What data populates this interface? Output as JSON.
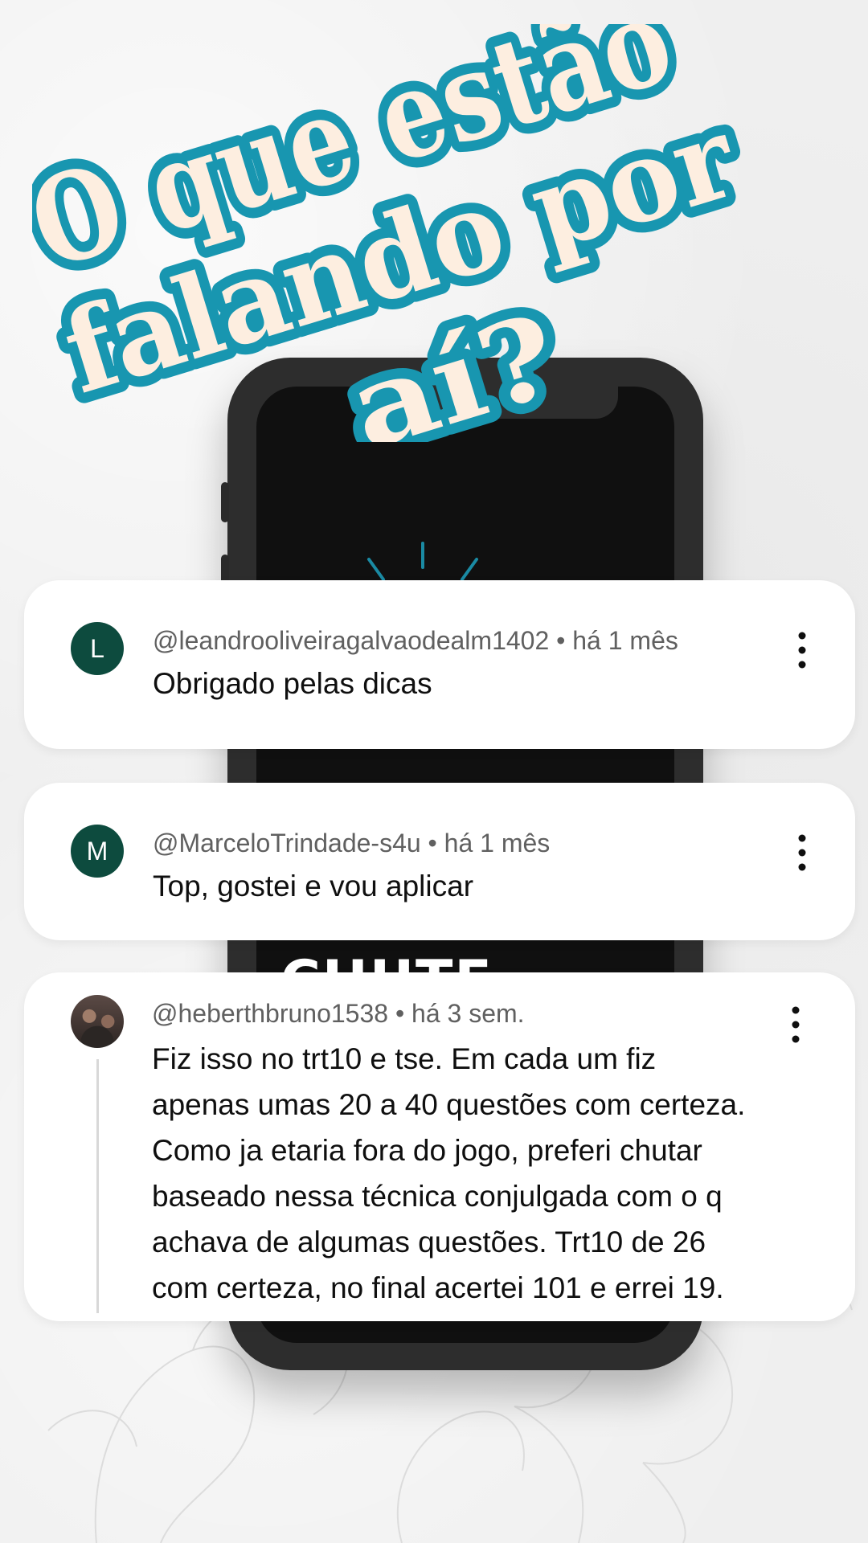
{
  "headline": {
    "line1": "O que estão",
    "line2": "falando por",
    "line3": "aí?",
    "fill_color": "#fdeee0",
    "outline_color": "#1896b0"
  },
  "phone": {
    "screen_partial_text": "CHUTE CERTA"
  },
  "comments": [
    {
      "avatar_letter": "L",
      "avatar_color": "#0d4b3e",
      "meta": "@leandrooliveiragalvaodealm1402 • há 1 mês",
      "text": "Obrigado pelas dicas",
      "menu_icon": "more-vert-icon"
    },
    {
      "avatar_letter": "M",
      "avatar_color": "#0d4b3e",
      "meta": "@MarceloTrindade-s4u • há 1 mês",
      "text": "Top, gostei e vou aplicar",
      "menu_icon": "more-vert-icon"
    },
    {
      "avatar_letter": "",
      "avatar_color": "",
      "meta": "@heberthbruno1538 • há 3 sem.",
      "text_lines": [
        "Fiz isso no trt10 e tse. Em cada um fiz",
        "apenas umas 20 a 40 questões com certeza.",
        "Como ja etaria fora do jogo, preferi chutar",
        "baseado nessa técnica conjulgada com o q",
        "achava de algumas questões. Trt10 de 26",
        "com certeza, no final acertei 101 e errei 19."
      ],
      "menu_icon": "more-vert-icon"
    }
  ]
}
